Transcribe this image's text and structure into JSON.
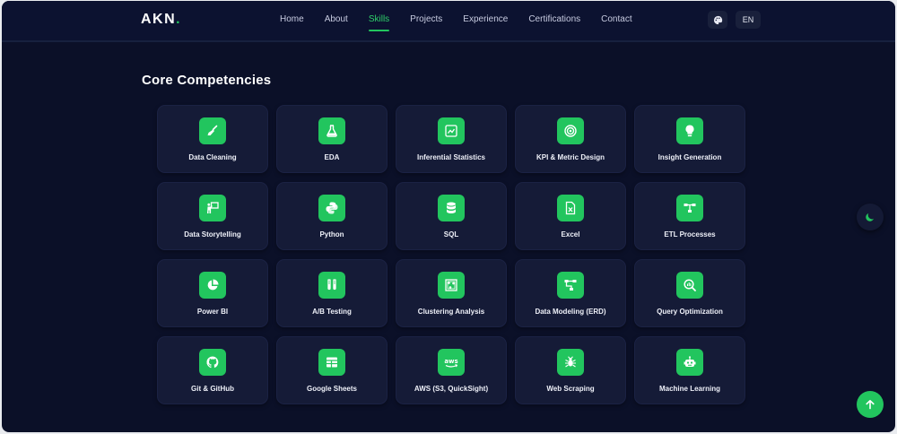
{
  "brand": {
    "logo_text": "AKN",
    "logo_dot": "."
  },
  "nav": {
    "links": [
      "Home",
      "About",
      "Skills",
      "Projects",
      "Experience",
      "Certifications",
      "Contact"
    ],
    "active": "Skills"
  },
  "header": {
    "language": "EN",
    "palette_icon": "palette-icon"
  },
  "section": {
    "title": "Core Competencies"
  },
  "skills": [
    {
      "label": "Data Cleaning",
      "icon": "broom-icon"
    },
    {
      "label": "EDA",
      "icon": "flask-icon"
    },
    {
      "label": "Inferential Statistics",
      "icon": "line-chart-icon"
    },
    {
      "label": "KPI & Metric Design",
      "icon": "target-icon"
    },
    {
      "label": "Insight Generation",
      "icon": "lightbulb-icon"
    },
    {
      "label": "Data Storytelling",
      "icon": "presenter-icon"
    },
    {
      "label": "Python",
      "icon": "python-icon"
    },
    {
      "label": "SQL",
      "icon": "database-icon"
    },
    {
      "label": "Excel",
      "icon": "excel-file-icon"
    },
    {
      "label": "ETL Processes",
      "icon": "pipeline-icon"
    },
    {
      "label": "Power BI",
      "icon": "pie-chart-icon"
    },
    {
      "label": "A/B Testing",
      "icon": "test-tubes-icon"
    },
    {
      "label": "Clustering Analysis",
      "icon": "clusters-icon"
    },
    {
      "label": "Data Modeling (ERD)",
      "icon": "schema-icon"
    },
    {
      "label": "Query Optimization",
      "icon": "search-chart-icon"
    },
    {
      "label": "Git & GitHub",
      "icon": "github-icon"
    },
    {
      "label": "Google Sheets",
      "icon": "sheet-icon"
    },
    {
      "label": "AWS (S3, QuickSight)",
      "icon": "aws-icon"
    },
    {
      "label": "Web Scraping",
      "icon": "spider-icon"
    },
    {
      "label": "Machine Learning",
      "icon": "robot-icon"
    }
  ],
  "floating": {
    "theme_icon": "moon-icon",
    "scroll_icon": "arrow-up-icon"
  },
  "colors": {
    "accent": "#22c55e",
    "background": "#0b1028",
    "card": "#151b37"
  }
}
